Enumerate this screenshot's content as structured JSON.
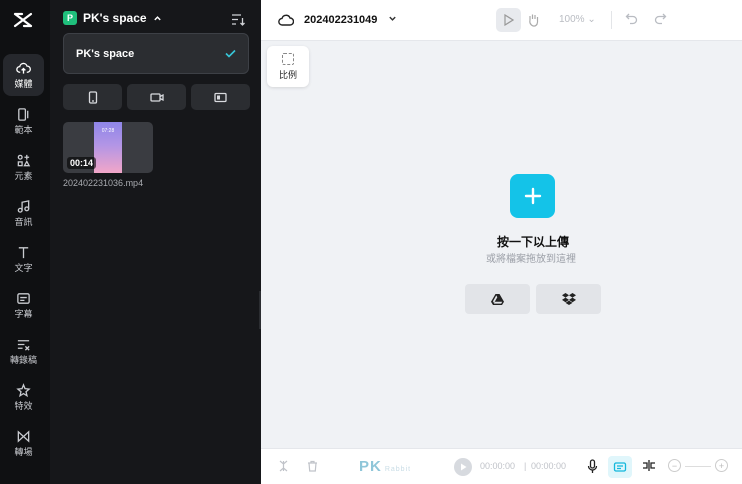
{
  "sidebar": {
    "items": [
      {
        "label": "媒體",
        "icon": "cloud-upload-icon"
      },
      {
        "label": "範本",
        "icon": "template-icon"
      },
      {
        "label": "元素",
        "icon": "elements-icon"
      },
      {
        "label": "音訊",
        "icon": "music-icon"
      },
      {
        "label": "文字",
        "icon": "text-icon"
      },
      {
        "label": "字幕",
        "icon": "captions-icon"
      },
      {
        "label": "轉錄稿",
        "icon": "transcript-icon"
      },
      {
        "label": "特效",
        "icon": "effects-icon"
      },
      {
        "label": "轉場",
        "icon": "transition-icon"
      }
    ]
  },
  "panel": {
    "space_badge": "P",
    "space_name": "PK's space",
    "dropdown_item": "PK's space",
    "media": [
      {
        "duration": "00:14",
        "filename": "202402231036.mp4",
        "thumb_time": "07:28"
      }
    ]
  },
  "topbar": {
    "project_name": "202402231049",
    "zoom": "100%"
  },
  "canvas": {
    "ratio_label": "比例",
    "upload_title": "按一下以上傳",
    "upload_subtitle": "或將檔案拖放到這裡"
  },
  "bottombar": {
    "current_time": "00:00:00",
    "total_time": "00:00:00",
    "watermark": "PK",
    "watermark_sub": "Rabbit"
  },
  "colors": {
    "accent": "#14c3e8",
    "rail_bg": "#0f1012",
    "panel_bg": "#16171a",
    "canvas_bg": "#f0f2f5"
  }
}
